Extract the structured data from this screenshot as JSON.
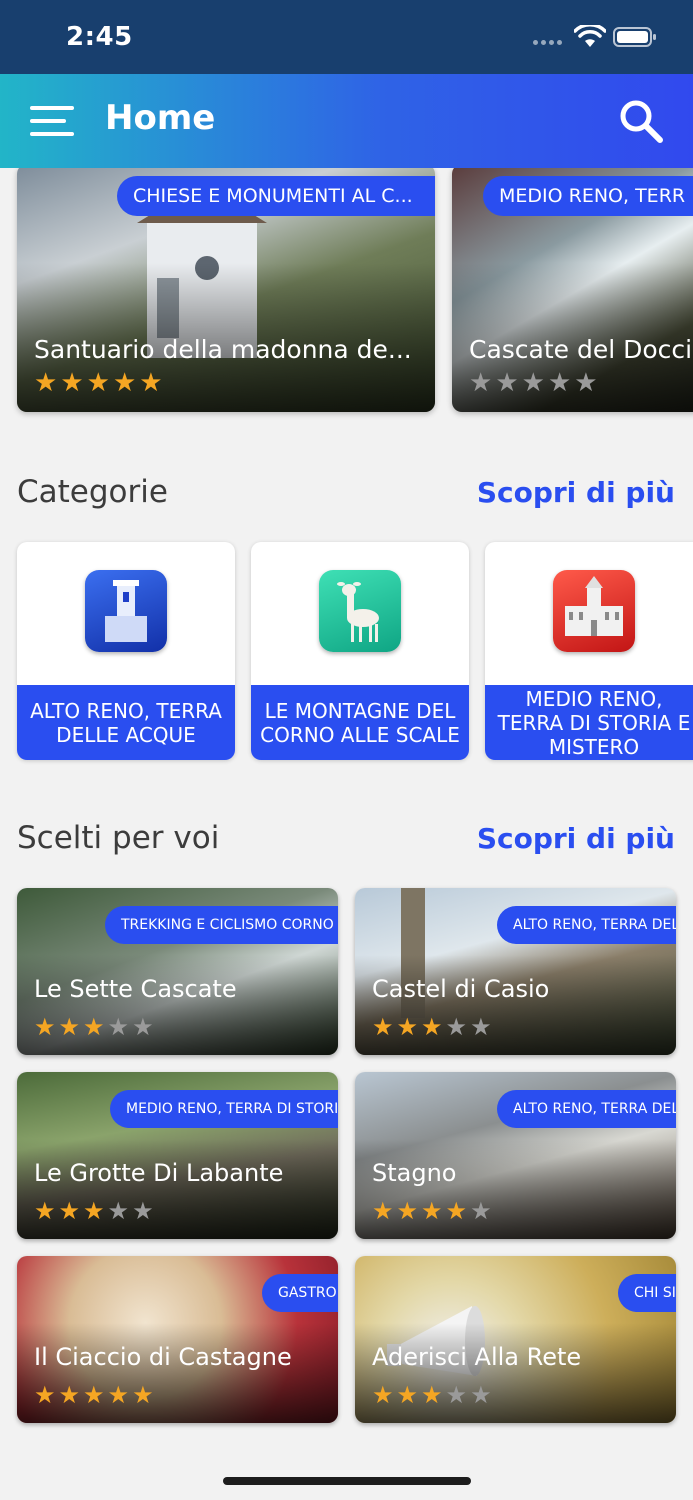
{
  "status": {
    "time": "2:45"
  },
  "header": {
    "title": "Home"
  },
  "featured": [
    {
      "tag": "CHIESE E MONUMENTI AL C...",
      "title": "Santuario della madonna de...",
      "rating": 5
    },
    {
      "tag": "MEDIO RENO, TERR",
      "title": "Cascate del Docci",
      "rating": 0
    }
  ],
  "categories": {
    "title": "Categorie",
    "more": "Scopri di più",
    "items": [
      {
        "label": "ALTO RENO, TERRA DELLE ACQUE",
        "icon": "tower-icon",
        "color": "#1f3fc8"
      },
      {
        "label": "LE MONTAGNE DEL CORNO ALLE SCALE",
        "icon": "deer-icon",
        "color": "#18c39a"
      },
      {
        "label": "MEDIO RENO, TERRA DI STORIA E MISTERO",
        "icon": "castle-icon",
        "color": "#e02424"
      }
    ]
  },
  "picks": {
    "title": "Scelti per voi",
    "more": "Scopri di più",
    "items": [
      {
        "tag": "TREKKING E CICLISMO CORNO A",
        "title": "Le Sette Cascate",
        "rating": 3
      },
      {
        "tag": "ALTO RENO, TERRA DEL",
        "title": "Castel di Casio",
        "rating": 3
      },
      {
        "tag": "MEDIO RENO, TERRA DI STORIA",
        "title": "Le Grotte Di Labante",
        "rating": 3
      },
      {
        "tag": "ALTO RENO, TERRA DEL",
        "title": "Stagno",
        "rating": 4
      },
      {
        "tag": "GASTRO",
        "title": "Il Ciaccio di Castagne",
        "rating": 5
      },
      {
        "tag": "CHI SIA",
        "title": "Aderisci Alla Rete",
        "rating": 3
      }
    ]
  },
  "colors": {
    "accent": "#2a4ef0",
    "star": "#f5a623",
    "status_bar": "#183f6e"
  }
}
